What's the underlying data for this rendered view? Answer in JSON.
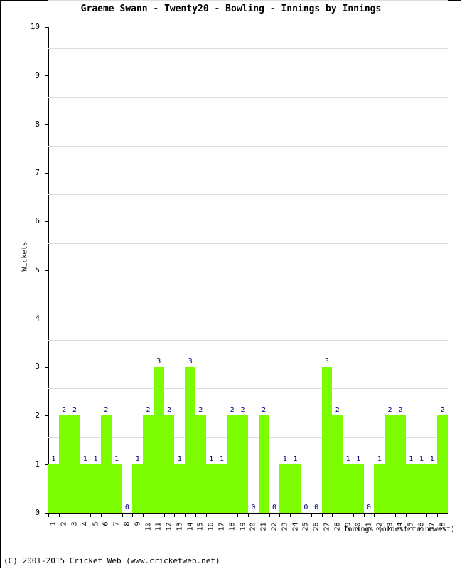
{
  "chart_data": {
    "type": "bar",
    "title": "Graeme Swann - Twenty20 - Bowling - Innings by Innings",
    "xlabel": "Innings (oldest to newest)",
    "ylabel": "Wickets",
    "ylim": [
      0,
      10
    ],
    "ytick_labels": [
      "0",
      "1",
      "2",
      "3",
      "4",
      "5",
      "6",
      "7",
      "8",
      "9",
      "10"
    ],
    "yticks": [
      0,
      1,
      2,
      3,
      4,
      5,
      6,
      7,
      8,
      9,
      10
    ],
    "grid": true,
    "legend": "none",
    "bar_color": "#7CFC00",
    "label_color": "#000080",
    "categories": [
      "1",
      "2",
      "3",
      "4",
      "5",
      "6",
      "7",
      "8",
      "9",
      "10",
      "11",
      "12",
      "13",
      "14",
      "15",
      "16",
      "17",
      "18",
      "19",
      "20",
      "21",
      "22",
      "23",
      "24",
      "25",
      "26",
      "27",
      "28",
      "29",
      "30",
      "31",
      "32",
      "33",
      "34",
      "35",
      "36",
      "37",
      "38"
    ],
    "values": [
      1,
      2,
      2,
      1,
      1,
      2,
      1,
      0,
      1,
      2,
      3,
      2,
      1,
      3,
      2,
      1,
      1,
      2,
      2,
      0,
      2,
      0,
      1,
      1,
      0,
      0,
      3,
      2,
      1,
      1,
      0,
      1,
      2,
      2,
      1,
      1,
      1,
      2
    ],
    "data_labels": [
      "1",
      "2",
      "2",
      "1",
      "1",
      "2",
      "1",
      "0",
      "1",
      "2",
      "3",
      "2",
      "1",
      "3",
      "2",
      "1",
      "1",
      "2",
      "2",
      "0",
      "2",
      "0",
      "1",
      "1",
      "0",
      "0",
      "3",
      "2",
      "1",
      "1",
      "0",
      "1",
      "2",
      "2",
      "1",
      "1",
      "1",
      "2"
    ]
  },
  "footer": {
    "copyright": "(C) 2001-2015 Cricket Web (www.cricketweb.net)"
  }
}
